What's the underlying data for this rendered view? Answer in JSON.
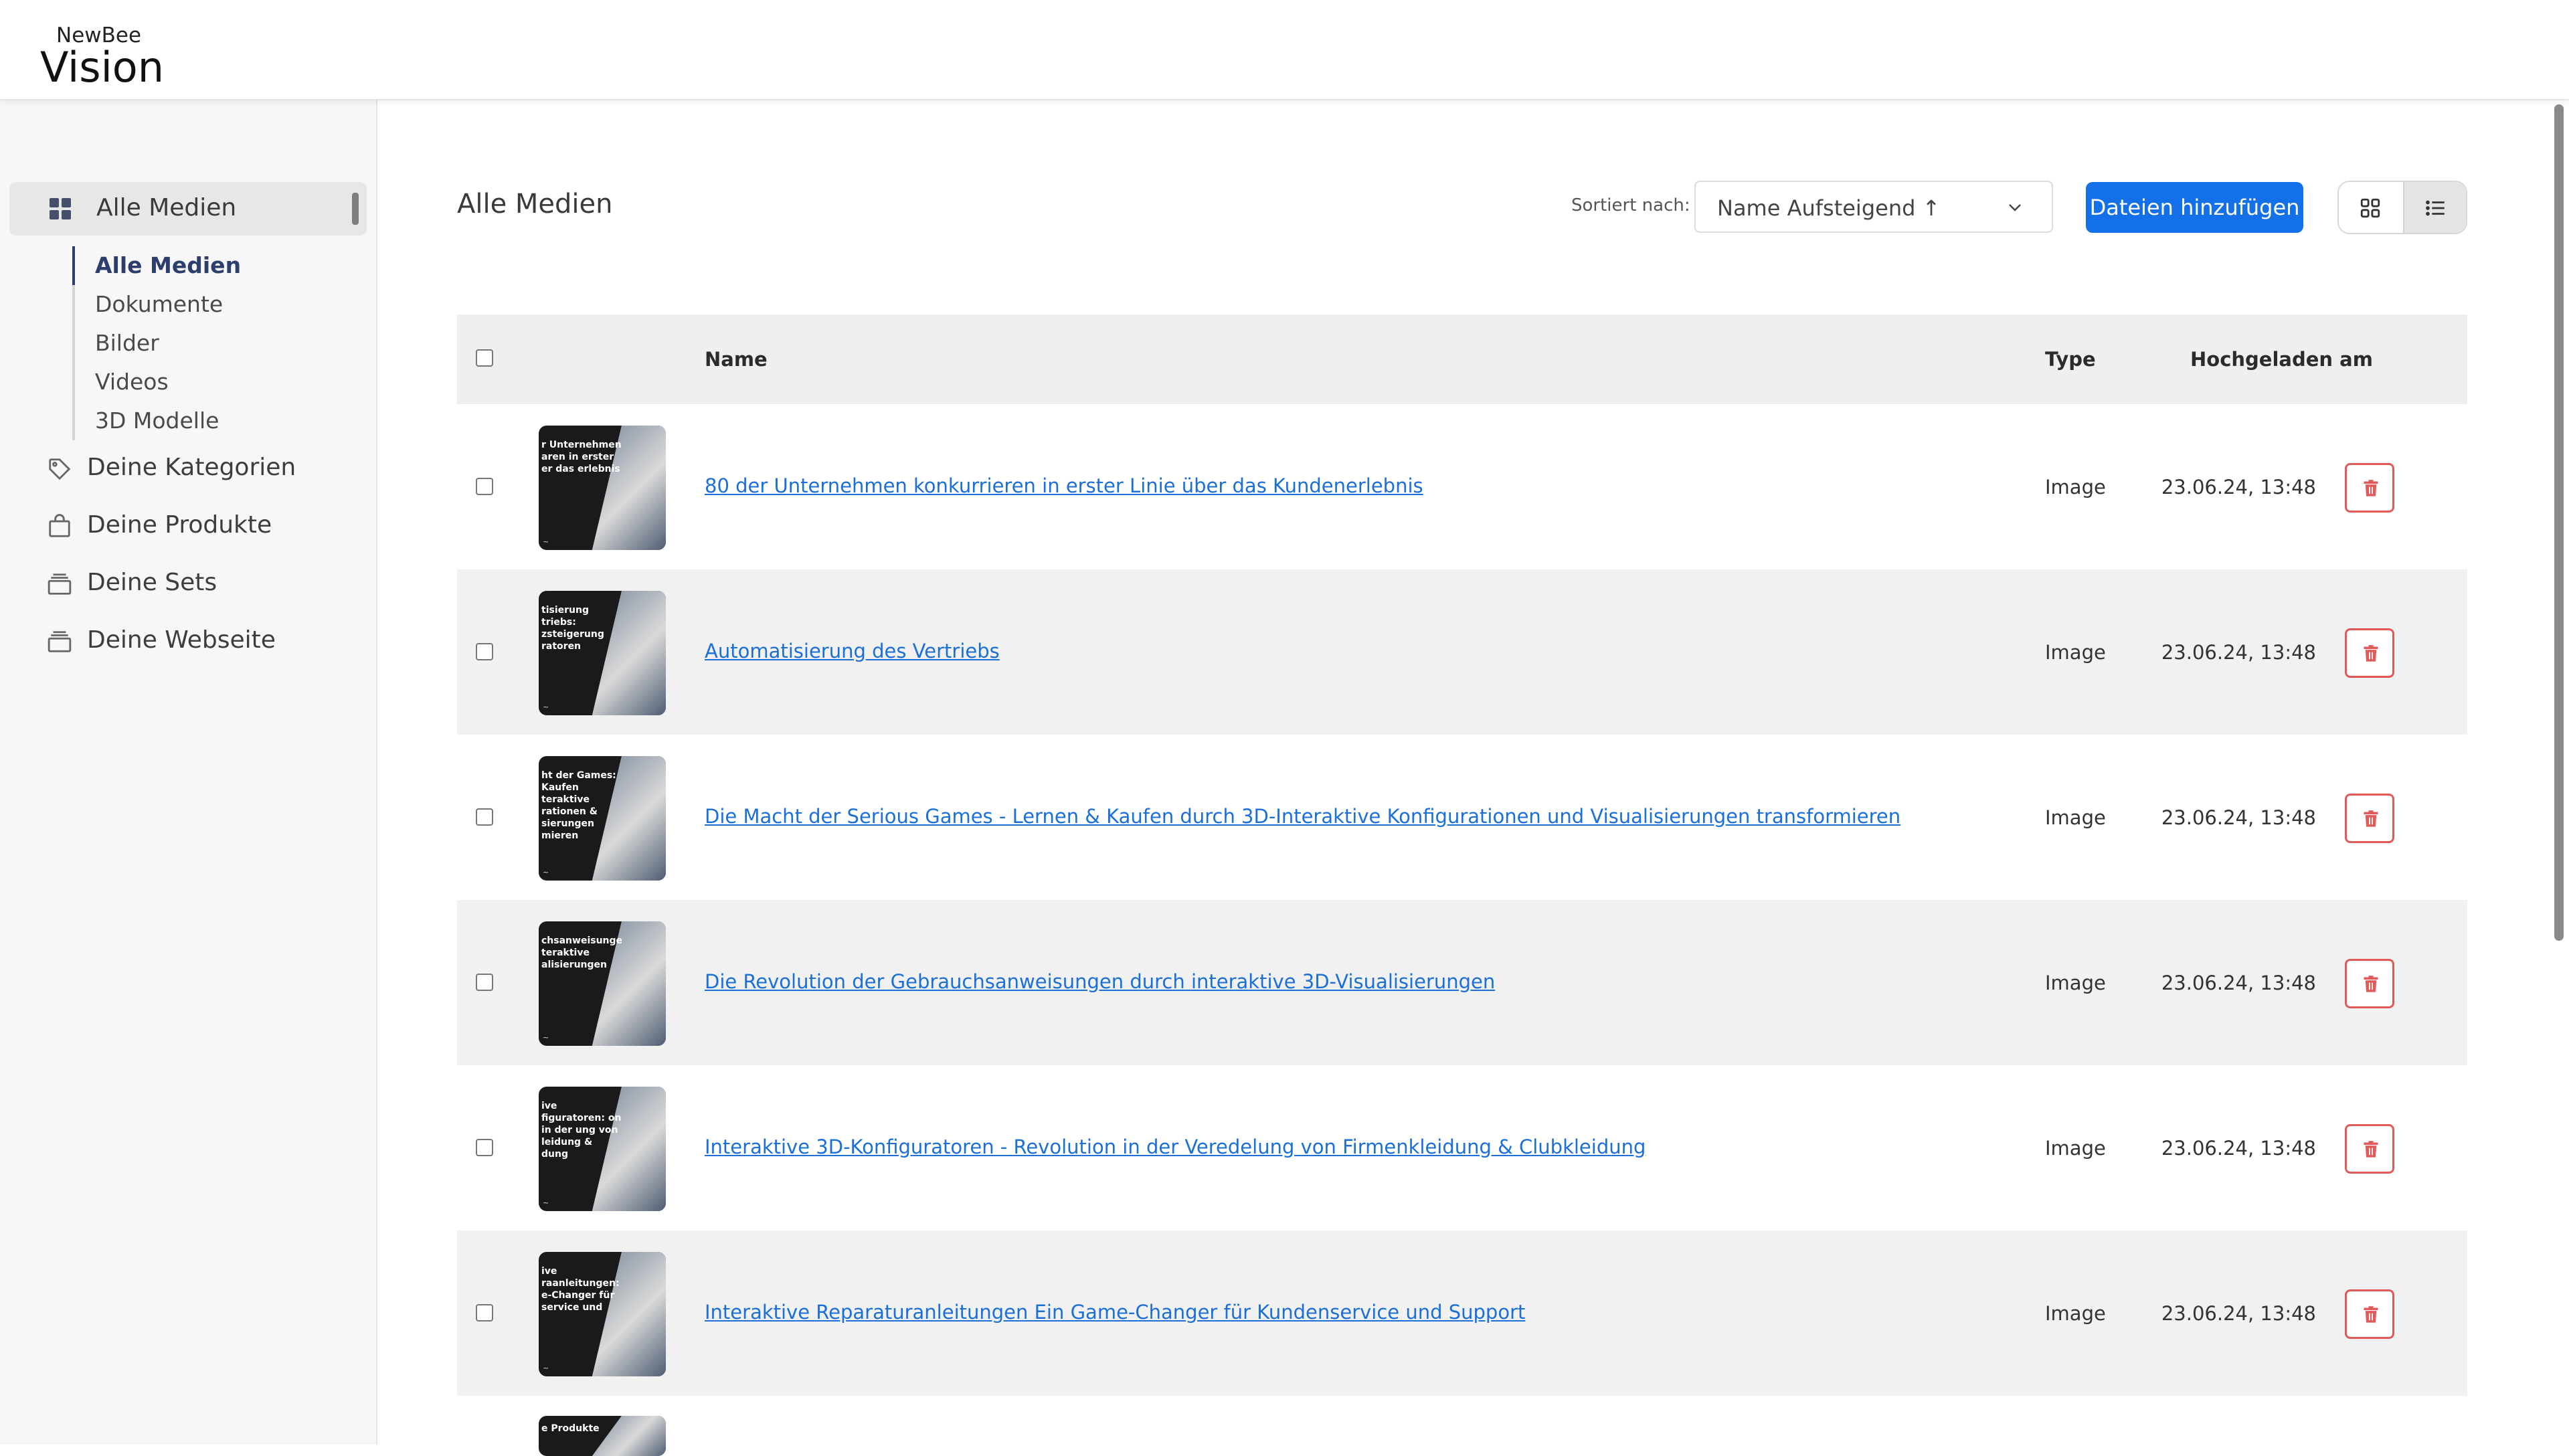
{
  "brand": {
    "small": "NewBee",
    "big": "Vision"
  },
  "sidebar": {
    "active": "Alle Medien",
    "subitems": [
      "Alle Medien",
      "Dokumente",
      "Bilder",
      "Videos",
      "3D Modelle"
    ],
    "items": [
      "Deine Kategorien",
      "Deine Produkte",
      "Deine Sets",
      "Deine Webseite"
    ]
  },
  "main": {
    "title": "Alle Medien",
    "sort_label": "Sortiert nach:",
    "sort_value": "Name Aufsteigend ↑",
    "add_button": "Dateien hinzufügen",
    "columns": {
      "name": "Name",
      "type": "Type",
      "uploaded": "Hochgeladen am"
    },
    "rows": [
      {
        "name": "80 der Unternehmen konkurrieren in erster Linie über das Kundenerlebnis",
        "type": "Image",
        "date": "23.06.24, 13:48",
        "thumb_text": "r Unternehmen aren in erster er das erlebnis"
      },
      {
        "name": "Automatisierung des Vertriebs",
        "type": "Image",
        "date": "23.06.24, 13:48",
        "thumb_text": "tisierung triebs: zsteigerung ratoren"
      },
      {
        "name": "Die Macht der Serious Games - Lernen & Kaufen durch 3D-Interaktive Konfigurationen und Visualisierungen transformieren",
        "type": "Image",
        "date": "23.06.24, 13:48",
        "thumb_text": "ht der Games: Kaufen teraktive rationen & sierungen mieren"
      },
      {
        "name": "Die Revolution der Gebrauchsanweisungen durch interaktive 3D-Visualisierungen",
        "type": "Image",
        "date": "23.06.24, 13:48",
        "thumb_text": "chsanweisungen teraktive alisierungen"
      },
      {
        "name": "Interaktive 3D-Konfiguratoren - Revolution in der Veredelung von Firmenkleidung & Clubkleidung",
        "type": "Image",
        "date": "23.06.24, 13:48",
        "thumb_text": "ive figuratoren: on in der ung von leidung & dung"
      },
      {
        "name": "Interaktive Reparaturanleitungen Ein Game-Changer für Kundenservice und Support",
        "type": "Image",
        "date": "23.06.24, 13:48",
        "thumb_text": "ive raanleitungen: e-Changer für service und"
      }
    ],
    "partial_row_thumb_text": "e Produkte"
  },
  "colors": {
    "primary": "#1470e8",
    "danger": "#e05a5a",
    "link": "#1a6fd9"
  }
}
